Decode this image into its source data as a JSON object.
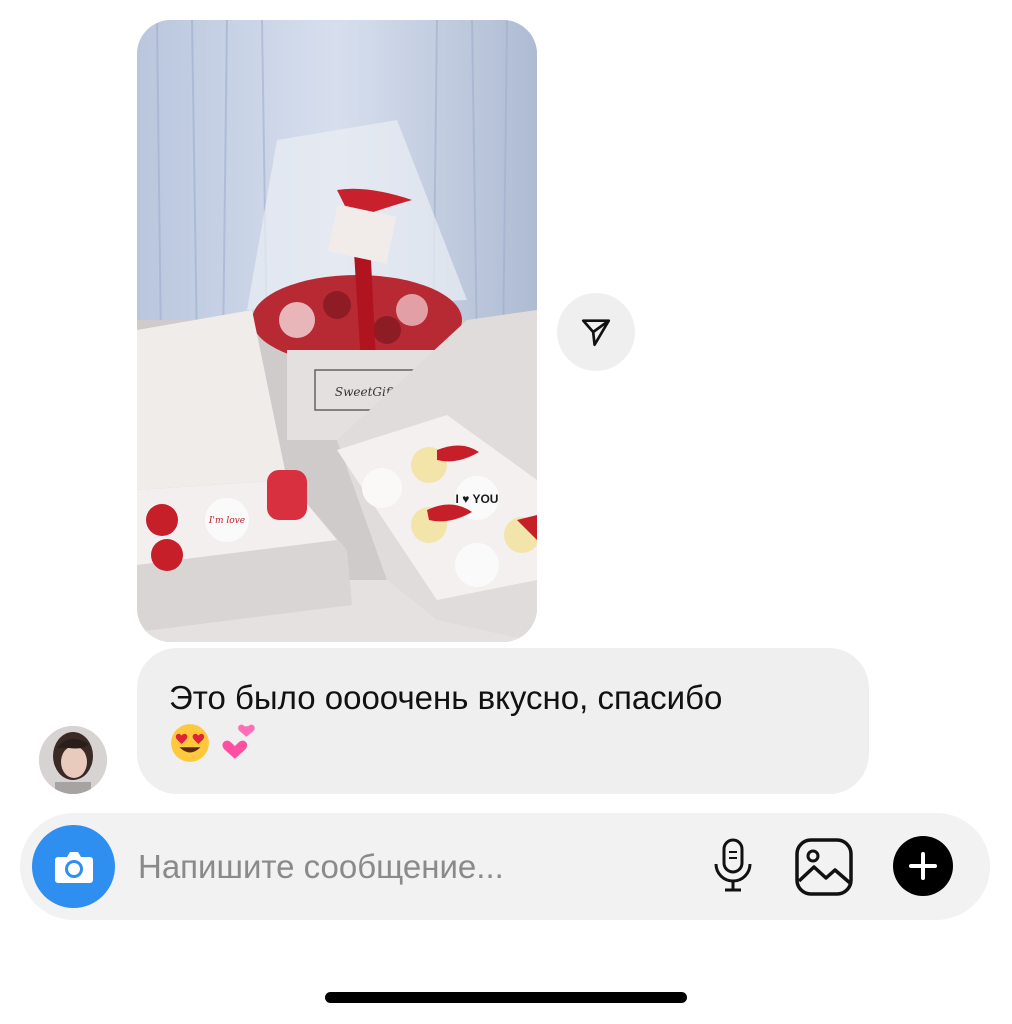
{
  "message_photo": {
    "icon": "photo-image",
    "box_brand": "SweetGift",
    "card_brand": "SweetGift",
    "macaron_text": "I'm love",
    "cupcake_text": "I ♥ YOU"
  },
  "share": {
    "icon": "paper-plane-icon"
  },
  "message_text": {
    "text": "Это было оооочень вкусно, спасибо",
    "emojis": [
      "😍",
      "💕"
    ]
  },
  "avatar": {
    "icon": "user-avatar"
  },
  "composer": {
    "placeholder": "Напишите сообщение...",
    "camera_icon": "camera-icon",
    "mic_icon": "microphone-icon",
    "gallery_icon": "image-icon",
    "plus_icon": "plus-icon",
    "accent_color": "#2f8ff0"
  }
}
